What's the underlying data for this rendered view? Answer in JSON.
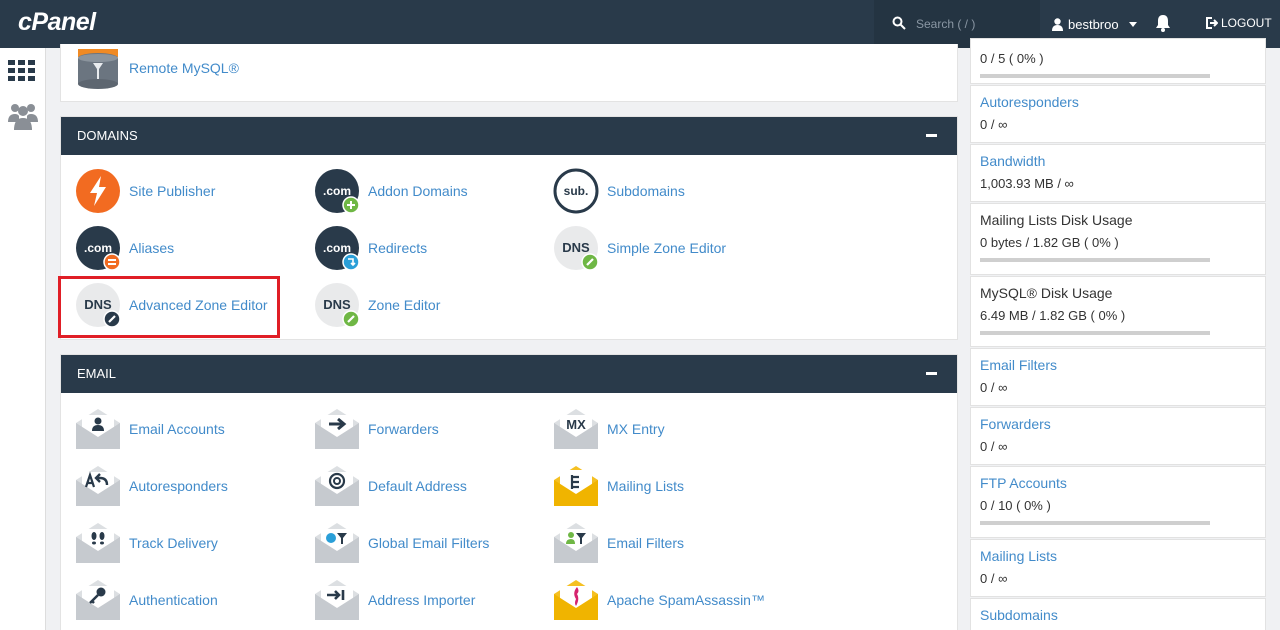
{
  "header": {
    "logo": "cPanel",
    "search_placeholder": "Search ( / )",
    "username": "bestbroo",
    "logout": "LOGOUT"
  },
  "databases": {
    "remote_mysql": "Remote MySQL®"
  },
  "domains": {
    "title": "DOMAINS",
    "items": [
      "Site Publisher",
      "Addon Domains",
      "Subdomains",
      "Aliases",
      "Redirects",
      "Simple Zone Editor",
      "Advanced Zone Editor",
      "Zone Editor"
    ]
  },
  "email": {
    "title": "EMAIL",
    "items": [
      "Email Accounts",
      "Forwarders",
      "MX Entry",
      "Autoresponders",
      "Default Address",
      "Mailing Lists",
      "Track Delivery",
      "Global Email Filters",
      "Email Filters",
      "Authentication",
      "Address Importer",
      "Apache SpamAssassin™"
    ]
  },
  "stats": [
    {
      "name": "",
      "value": "0 / 5 ( 0% )",
      "fill": 0
    },
    {
      "name": "Autoresponders",
      "value": "0 / ∞"
    },
    {
      "name": "Bandwidth",
      "value": "1,003.93 MB / ∞"
    },
    {
      "name": "Mailing Lists Disk Usage",
      "value": "0 bytes / 1.82 GB ( 0% )",
      "fill": 0
    },
    {
      "name": "MySQL® Disk Usage",
      "value": "6.49 MB / 1.82 GB ( 0% )",
      "fill": 0
    },
    {
      "name": "Email Filters",
      "value": "0 / ∞"
    },
    {
      "name": "Forwarders",
      "value": "0 / ∞"
    },
    {
      "name": "FTP Accounts",
      "value": "0 / 10 ( 0% )",
      "fill": 0
    },
    {
      "name": "Mailing Lists",
      "value": "0 / ∞"
    },
    {
      "name": "Subdomains",
      "value": ""
    }
  ],
  "icons": {
    "com_text": ".com",
    "sub_text": "sub.",
    "dns_text": "DNS",
    "mx_text": "MX"
  },
  "colors": {
    "header_bg": "#293a4a",
    "link": "#428bca",
    "highlight": "#e01e26",
    "site_publisher": "#f26b21"
  }
}
